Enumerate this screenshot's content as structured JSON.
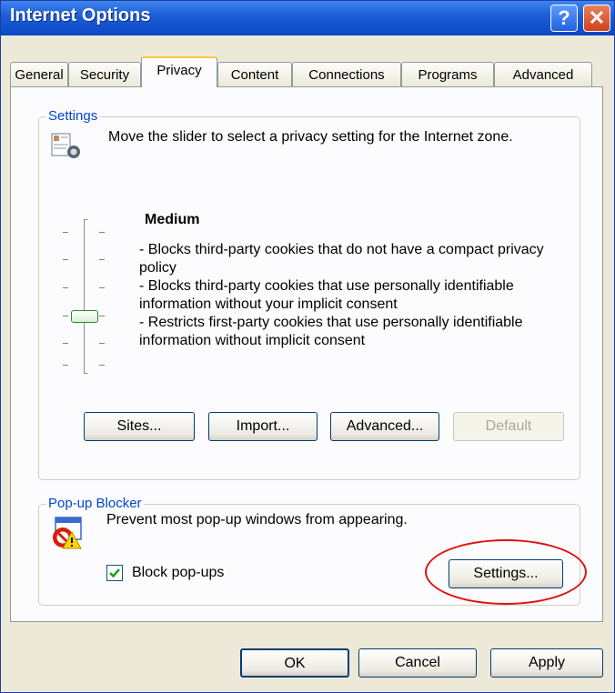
{
  "window": {
    "title": "Internet Options",
    "help_glyph": "?",
    "close_glyph": "✕"
  },
  "tabs": [
    {
      "label": "General"
    },
    {
      "label": "Security"
    },
    {
      "label": "Privacy",
      "active": true
    },
    {
      "label": "Content"
    },
    {
      "label": "Connections"
    },
    {
      "label": "Programs"
    },
    {
      "label": "Advanced"
    }
  ],
  "settings": {
    "legend": "Settings",
    "description": "Move the slider to select a privacy setting for the Internet zone.",
    "level_title": "Medium",
    "level_lines": [
      "- Blocks third-party cookies that do not have a compact privacy policy",
      "- Blocks third-party cookies that use personally identifiable information without your implicit consent",
      "- Restricts first-party cookies that use personally identifiable information without implicit consent"
    ],
    "slider": {
      "position_index": 3,
      "steps": 6
    },
    "buttons": {
      "sites": "Sites...",
      "import": "Import...",
      "advanced": "Advanced...",
      "default": "Default"
    }
  },
  "popup": {
    "legend": "Pop-up Blocker",
    "description": "Prevent most pop-up windows from appearing.",
    "checkbox_label": "Block pop-ups",
    "checkbox_checked": true,
    "settings_button": "Settings..."
  },
  "footer": {
    "ok": "OK",
    "cancel": "Cancel",
    "apply": "Apply"
  },
  "colors": {
    "title_bar": "#0a47c4",
    "legend_text": "#0046d5",
    "highlight_circle": "#e01010"
  }
}
